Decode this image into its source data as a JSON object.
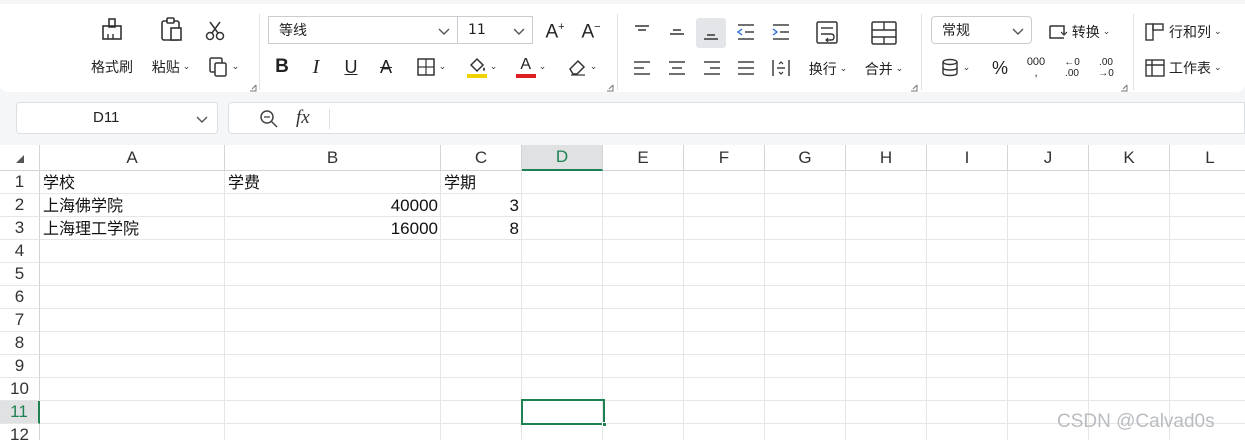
{
  "ribbon": {
    "format_painter_label": "格式刷",
    "paste_label": "粘贴",
    "font_name": "等线",
    "font_size": "11",
    "wrap_label": "换行",
    "merge_label": "合并",
    "number_format": "常规",
    "convert_label": "转换",
    "row_col_label": "行和列",
    "worksheet_label": "工作表",
    "highlight_color": "#f0d200",
    "font_color": "#e02020"
  },
  "formula_bar": {
    "name_box": "D11",
    "fx_label": "fx",
    "formula": ""
  },
  "sheet": {
    "columns": [
      "A",
      "B",
      "C",
      "D",
      "E",
      "F",
      "G",
      "H",
      "I",
      "J",
      "K",
      "L"
    ],
    "rows": [
      "1",
      "2",
      "3",
      "4",
      "5",
      "6",
      "7",
      "8",
      "9",
      "10",
      "11",
      "12"
    ],
    "active_column": "D",
    "active_row": "11",
    "cells": {
      "A1": "学校",
      "B1": "学费",
      "C1": "学期",
      "A2": "上海佛学院",
      "B2": "40000",
      "C2": "3",
      "A3": "上海理工学院",
      "B3": "16000",
      "C3": "8"
    }
  },
  "watermark": "CSDN @Calvad0s",
  "accent_color": "#1e8152"
}
